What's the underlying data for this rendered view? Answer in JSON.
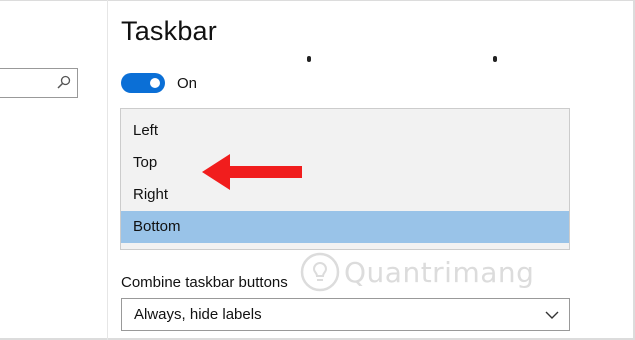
{
  "page": {
    "title": "Taskbar"
  },
  "search": {
    "icon": "search-icon",
    "placeholder": ""
  },
  "toggle": {
    "state_label": "On",
    "on": true,
    "color": "#0b6fd6"
  },
  "location_dropdown": {
    "options": [
      {
        "label": "Left"
      },
      {
        "label": "Top"
      },
      {
        "label": "Right"
      },
      {
        "label": "Bottom",
        "selected": true
      }
    ],
    "selected_color": "#99c3e8"
  },
  "annotation": {
    "icon": "red-arrow-icon",
    "color": "#f11d1d"
  },
  "combine": {
    "label": "Combine taskbar buttons",
    "value": "Always, hide labels",
    "icon": "chevron-down-icon"
  },
  "watermark": {
    "text": "Quantrimang",
    "icon": "lightbulb-icon"
  }
}
